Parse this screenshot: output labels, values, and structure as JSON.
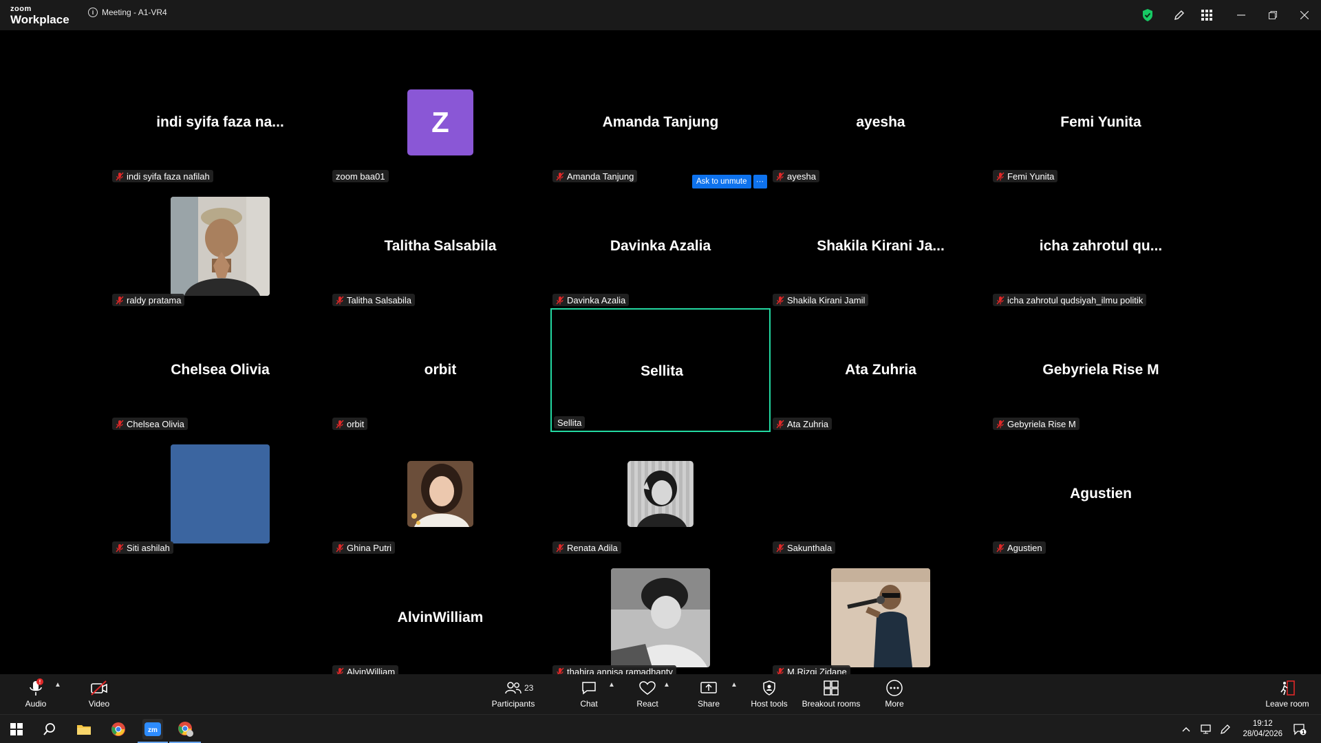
{
  "app": {
    "logo_top": "zoom",
    "logo_bottom": "Workplace",
    "meeting_title": "Meeting - A1-VR4"
  },
  "ask_to_unmute": {
    "label": "Ask to unmute",
    "more": "···"
  },
  "participants": [
    {
      "big": "indi syifa faza na...",
      "name": "indi syifa faza nafilah",
      "muted": true
    },
    {
      "avatar_letter": "Z",
      "avatar_color": "#8a57d6",
      "name": "zoom baa01",
      "muted": false
    },
    {
      "big": "Amanda Tanjung",
      "name": "Amanda Tanjung",
      "muted": true
    },
    {
      "big": "ayesha",
      "name": "ayesha",
      "muted": true
    },
    {
      "big": "Femi Yunita",
      "name": "Femi Yunita",
      "muted": true
    },
    {
      "photo": "photo-man-cap",
      "name": "raldy pratama",
      "muted": true
    },
    {
      "big": "Talitha Salsabila",
      "name": "Talitha Salsabila",
      "muted": true
    },
    {
      "big": "Davinka Azalia",
      "name": "Davinka Azalia",
      "muted": true
    },
    {
      "big": "Shakila Kirani Ja...",
      "name": "Shakila Kirani Jamil",
      "muted": true
    },
    {
      "big": "icha zahrotul qu...",
      "name": "icha zahrotul qudsiyah_ilmu politik",
      "muted": true
    },
    {
      "big": "Chelsea Olivia",
      "name": "Chelsea Olivia",
      "muted": true
    },
    {
      "big": "orbit",
      "name": "orbit",
      "muted": true
    },
    {
      "big": "Sellita",
      "name": "Sellita",
      "muted": false,
      "active": true
    },
    {
      "big": "Ata Zuhria",
      "name": "Ata Zuhria",
      "muted": true
    },
    {
      "big": "Gebyriela Rise M",
      "name": "Gebyriela Rise M",
      "muted": true
    },
    {
      "photo": "photo-blue",
      "name": "Siti ashilah",
      "muted": true
    },
    {
      "avatar_photo": "photo-woman",
      "name": "Ghina Putri",
      "muted": true
    },
    {
      "avatar_photo": "photo-bw-girl",
      "name": "Renata Adila",
      "muted": true
    },
    {
      "avatar_photo": "photo-black",
      "name": "Sakunthala",
      "muted": true
    },
    {
      "big": "Agustien",
      "name": "Agustien",
      "muted": true
    },
    {
      "empty": true
    },
    {
      "big": "AlvinWilliam",
      "name": "AlvinWilliam",
      "muted": true
    },
    {
      "photo": "photo-bw-boy",
      "name": "thahira annisa ramadhanty",
      "muted": true
    },
    {
      "photo": "photo-mic",
      "name": "M.Rizqi Zidane",
      "muted": true
    }
  ],
  "toolbar": {
    "audio": "Audio",
    "video": "Video",
    "participants": "Participants",
    "participants_count": "23",
    "chat": "Chat",
    "react": "React",
    "share": "Share",
    "host_tools": "Host tools",
    "breakout_rooms": "Breakout rooms",
    "more": "More",
    "leave_room": "Leave room"
  },
  "taskbar": {
    "time": "19:12",
    "date": "28/04/2026",
    "notifications": "1"
  },
  "colors": {
    "accent_blue": "#0e72ed",
    "active_border": "#23d9a2",
    "mute_red": "#e02828",
    "secure_green": "#17c964"
  }
}
